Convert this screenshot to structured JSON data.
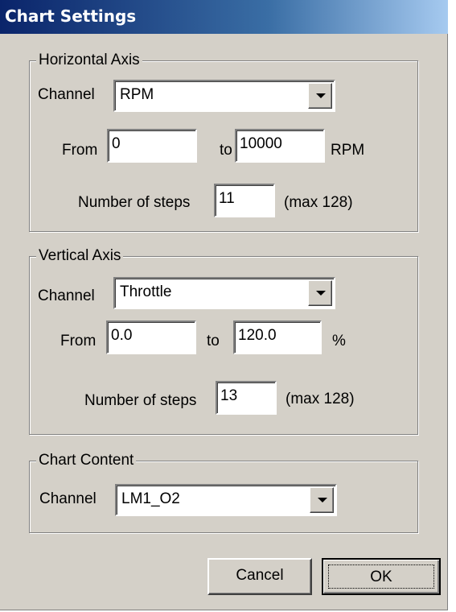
{
  "window": {
    "title": "Chart Settings"
  },
  "horizontal_axis": {
    "legend": "Horizontal Axis",
    "channel_label": "Channel",
    "channel_value": "RPM",
    "from_label": "From",
    "from_value": "0",
    "to_label": "to",
    "to_value": "10000",
    "unit": "RPM",
    "steps_label": "Number of steps",
    "steps_value": "11",
    "steps_max": "(max 128)"
  },
  "vertical_axis": {
    "legend": "Vertical Axis",
    "channel_label": "Channel",
    "channel_value": "Throttle",
    "from_label": "From",
    "from_value": "0.0",
    "to_label": "to",
    "to_value": "120.0",
    "unit": "%",
    "steps_label": "Number of steps",
    "steps_value": "13",
    "steps_max": "(max 128)"
  },
  "chart_content": {
    "legend": "Chart Content",
    "channel_label": "Channel",
    "channel_value": "LM1_O2"
  },
  "buttons": {
    "cancel": "Cancel",
    "ok": "OK"
  },
  "colors": {
    "dialog_face": "#d4d0c8",
    "title_gradient_start": "#0a246a",
    "title_gradient_end": "#a6caf0",
    "title_text": "#ffffff"
  },
  "icons": {
    "dropdown": "chevron-down-icon"
  }
}
